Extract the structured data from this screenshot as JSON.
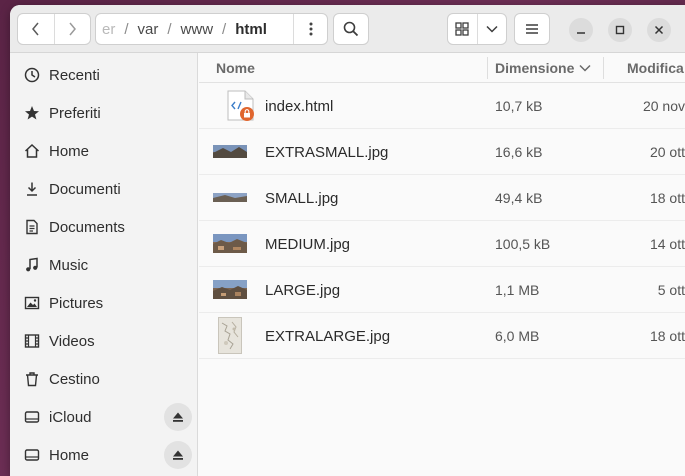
{
  "pathbar": {
    "crumbs": [
      "er",
      "var",
      "www",
      "html"
    ],
    "separator": "/"
  },
  "sidebar": {
    "items": [
      {
        "label": "Recenti",
        "icon": "clock-icon"
      },
      {
        "label": "Preferiti",
        "icon": "star-icon"
      },
      {
        "label": "Home",
        "icon": "home-icon"
      },
      {
        "label": "Documenti",
        "icon": "download-icon"
      },
      {
        "label": "Documents",
        "icon": "document-icon"
      },
      {
        "label": "Music",
        "icon": "music-icon"
      },
      {
        "label": "Pictures",
        "icon": "picture-icon"
      },
      {
        "label": "Videos",
        "icon": "film-icon"
      },
      {
        "label": "Cestino",
        "icon": "trash-icon"
      },
      {
        "label": "iCloud",
        "icon": "drive-icon"
      },
      {
        "label": "Home",
        "icon": "drive-icon"
      }
    ]
  },
  "columns": {
    "name": "Nome",
    "size": "Dimensione",
    "modified": "Modifica"
  },
  "files": [
    {
      "name": "index.html",
      "size": "10,7 kB",
      "date": "20 nov",
      "thumb": "html-lock-icon"
    },
    {
      "name": "EXTRASMALL.jpg",
      "size": "16,6 kB",
      "date": "20 ott",
      "thumb": "image-thumb"
    },
    {
      "name": "SMALL.jpg",
      "size": "49,4 kB",
      "date": "18 ott",
      "thumb": "image-thumb"
    },
    {
      "name": "MEDIUM.jpg",
      "size": "100,5 kB",
      "date": "14 ott",
      "thumb": "image-thumb"
    },
    {
      "name": "LARGE.jpg",
      "size": "1,1 MB",
      "date": "5 ott",
      "thumb": "image-thumb"
    },
    {
      "name": "EXTRALARGE.jpg",
      "size": "6,0 MB",
      "date": "18 ott",
      "thumb": "image-thumb"
    }
  ],
  "colors": {
    "accent_lock": "#e0662f",
    "html_icon": "#3d7ec9",
    "desktop": "#5b2446"
  }
}
